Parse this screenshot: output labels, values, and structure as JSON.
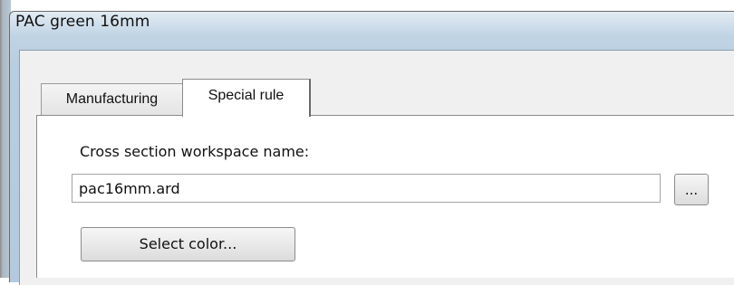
{
  "window": {
    "title": "PAC green 16mm"
  },
  "tabs": [
    {
      "label": "Manufacturing",
      "selected": false
    },
    {
      "label": "Special rule",
      "selected": true
    }
  ],
  "special_rule": {
    "workspace_label": "Cross section workspace name:",
    "workspace_value": "pac16mm.ard",
    "browse_label": "...",
    "select_color_label": "Select color..."
  }
}
